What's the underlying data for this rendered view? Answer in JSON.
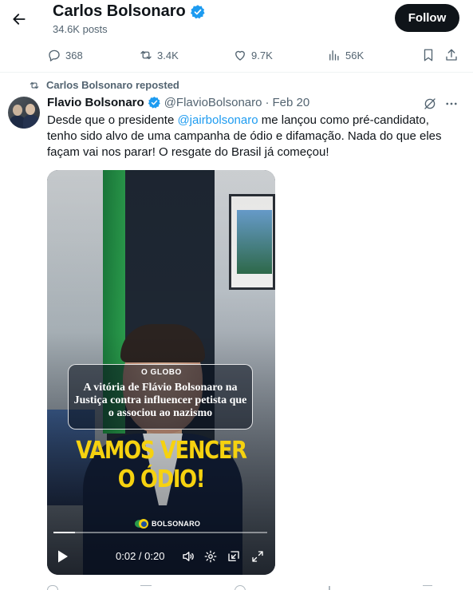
{
  "header": {
    "name": "Carlos Bolsonaro",
    "posts": "34.6K posts",
    "follow_label": "Follow"
  },
  "top_actions": {
    "replies": "368",
    "reposts": "3.4K",
    "likes": "9.7K",
    "views": "56K"
  },
  "repost_line": "Carlos Bolsonaro reposted",
  "tweet": {
    "name": "Flavio Bolsonaro",
    "handle": "@FlavioBolsonaro",
    "separator": "·",
    "date": "Feb 20",
    "text_before": "Desde que o presidente ",
    "mention": "@jairbolsonaro",
    "text_after": " me lançou como pré-candidato, tenho sido alvo de uma campanha de ódio e difamação. Nada do que eles façam vai nos parar! O resgate do Brasil já começou!"
  },
  "video": {
    "outlet": "O GLOBO",
    "headline": "A vitória de Flávio Bolsonaro na Justiça contra influencer petista que o associou ao nazismo",
    "slogan_line1": "VAMOS VENCER",
    "slogan_line2": "O ÓDIO!",
    "brand": "BOLSONARO",
    "time": "0:02 / 0:20",
    "progress": 0.1
  },
  "colors": {
    "accent": "#1d9bf0",
    "text": "#0f1419",
    "muted": "#536471",
    "slogan": "#f6d20f"
  }
}
